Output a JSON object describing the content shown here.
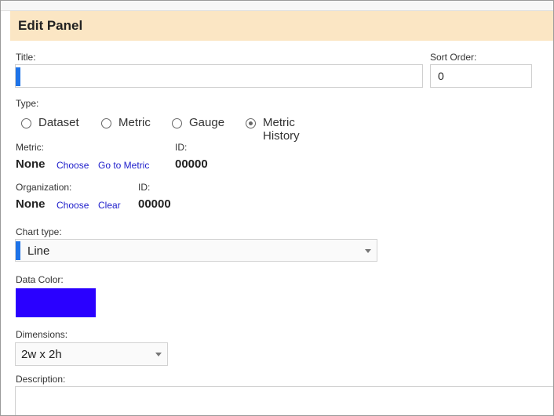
{
  "panel": {
    "title": "Edit Panel"
  },
  "fields": {
    "title_label": "Title:",
    "title_value": "",
    "sort_label": "Sort Order:",
    "sort_value": "0",
    "type_label": "Type:",
    "type_options": [
      "Dataset",
      "Metric",
      "Gauge",
      "Metric History"
    ],
    "type_selected": "Metric History",
    "metric_label": "Metric:",
    "metric_value": "None",
    "metric_choose": "Choose",
    "metric_goto": "Go to Metric",
    "metric_id_label": "ID:",
    "metric_id_value": "00000",
    "org_label": "Organization:",
    "org_value": "None",
    "org_choose": "Choose",
    "org_clear": "Clear",
    "org_id_label": "ID:",
    "org_id_value": "00000",
    "chart_type_label": "Chart type:",
    "chart_type_value": "Line",
    "data_color_label": "Data Color:",
    "data_color": "#2a00ff",
    "dimensions_label": "Dimensions:",
    "dimensions_value": "2w x 2h",
    "description_label": "Description:",
    "description_value": ""
  },
  "colors": {
    "header_bg": "#fbe6c4",
    "focus_accent": "#1e73e8",
    "link": "#2020cc"
  }
}
